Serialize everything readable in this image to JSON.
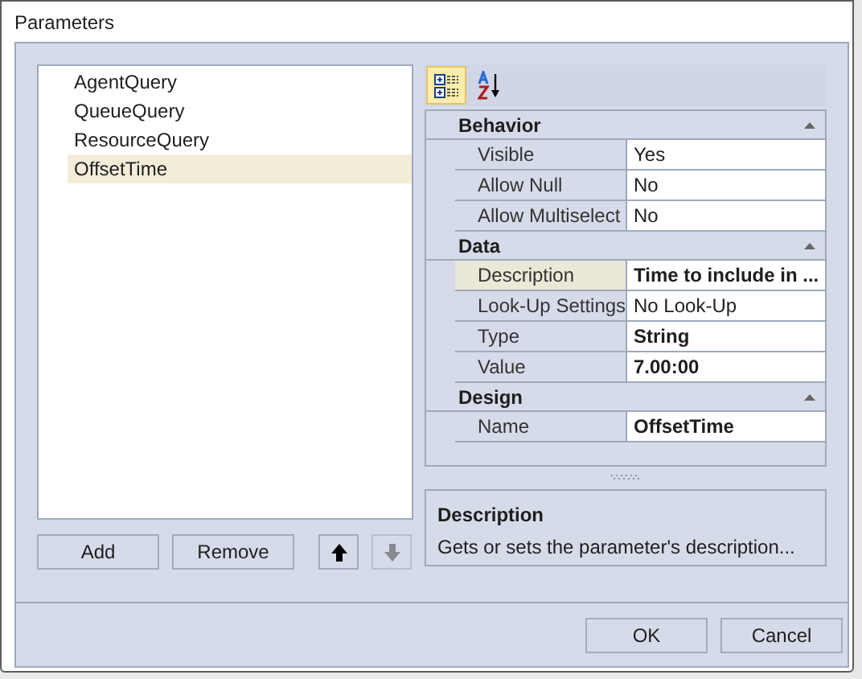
{
  "window": {
    "title": "Parameters"
  },
  "parameters": [
    {
      "label": "AgentQuery",
      "selected": false
    },
    {
      "label": "QueueQuery",
      "selected": false
    },
    {
      "label": "ResourceQuery",
      "selected": false
    },
    {
      "label": "OffsetTime",
      "selected": true
    }
  ],
  "list_buttons": [
    {
      "kind": "text",
      "label": "Add"
    },
    {
      "kind": "text",
      "label": "Remove"
    },
    {
      "kind": "up",
      "disabled": false
    },
    {
      "kind": "down",
      "disabled": true
    }
  ],
  "toolbar": [
    {
      "kind": "categorized",
      "selected": true
    },
    {
      "kind": "alphabetical",
      "selected": false
    }
  ],
  "categories": [
    {
      "name": "Behavior",
      "expanded": true,
      "properties": [
        {
          "name": "Visible",
          "value": "Yes",
          "bold": false,
          "selected": false
        },
        {
          "name": "Allow Null",
          "value": "No",
          "bold": false,
          "selected": false
        },
        {
          "name": "Allow Multiselect",
          "value": "No",
          "bold": false,
          "selected": false
        }
      ]
    },
    {
      "name": "Data",
      "expanded": true,
      "properties": [
        {
          "name": "Description",
          "value": "Time to include in ...",
          "bold": true,
          "selected": true
        },
        {
          "name": "Look-Up Settings",
          "value": "No Look-Up",
          "bold": false,
          "selected": false
        },
        {
          "name": "Type",
          "value": "String",
          "bold": true,
          "selected": false
        },
        {
          "name": "Value",
          "value": "7.00:00",
          "bold": true,
          "selected": false
        }
      ]
    },
    {
      "name": "Design",
      "expanded": true,
      "properties": [
        {
          "name": "Name",
          "value": "OffsetTime",
          "bold": true,
          "selected": false
        }
      ]
    }
  ],
  "description_panel": {
    "title": "Description",
    "text": "Gets or sets the parameter's description..."
  },
  "footer_buttons": [
    "OK",
    "Cancel"
  ]
}
